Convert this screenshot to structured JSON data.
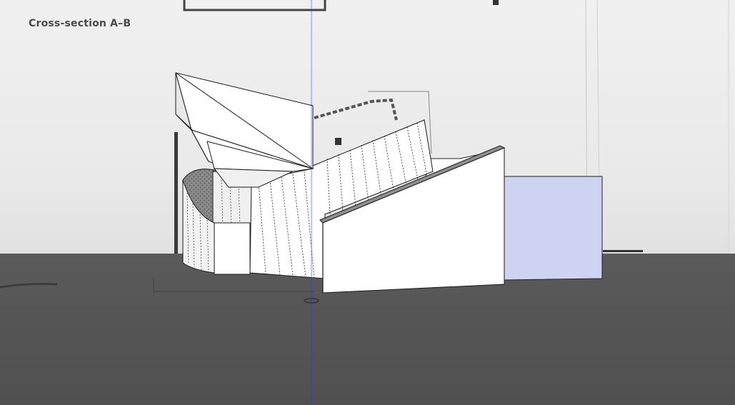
{
  "viewport": {
    "title": "Cross-section A–B"
  },
  "colors": {
    "sky": "#ececec",
    "ground": "#575757",
    "model_face": "#ffffff",
    "model_edge": "#1a1a1a",
    "blue_box": "#cfd3f2",
    "blue_axis": "#2a36d6"
  }
}
